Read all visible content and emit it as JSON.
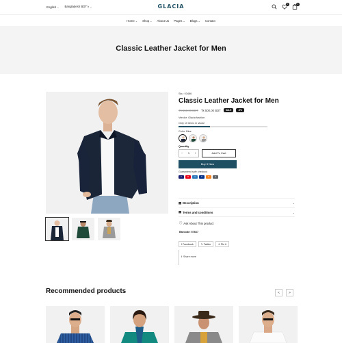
{
  "topbar": {
    "language": "English",
    "currency": "Bangladesh BDT ৳",
    "logo": "GLACIA",
    "wishlist_count": "0",
    "cart_count": "0"
  },
  "nav": [
    {
      "label": "Home",
      "dropdown": true
    },
    {
      "label": "Shop",
      "dropdown": true
    },
    {
      "label": "About Us",
      "dropdown": false
    },
    {
      "label": "Pages",
      "dropdown": true
    },
    {
      "label": "Blogs",
      "dropdown": true
    },
    {
      "label": "Contact",
      "dropdown": false
    }
  ],
  "hero": {
    "title": "Classic Leather Jacket for Men"
  },
  "product": {
    "sku": "Sku: 03486",
    "title": "Classic Leather Jacket for Men",
    "old_price": "Tk 550.00 BDT",
    "new_price": "Tk 500.00 BDT",
    "sale_label": "SALE",
    "discount_label": "-9%",
    "vendor": "Vendor: Glacia fashion",
    "stock_text": "Only 10 items in stock!",
    "stock_level": 0.35,
    "color_label": "Color: Blue",
    "colors": [
      "Blue",
      "Green",
      "Grey"
    ],
    "quantity_label": "Quantity",
    "quantity_value": "1",
    "add_to_cart": "Add To Cart",
    "buy_now": "Buy It Now",
    "guarantee": "Guaranteed safe checkout",
    "payment_icons": [
      "VISA",
      "MC",
      "AMEX",
      "PP",
      "DI",
      "GP"
    ],
    "description_label": "Description",
    "terms_label": "Terms and conditions",
    "ask_label": "Ask About This product",
    "barcode": "Barcode: 57667",
    "share_facebook": "Facebook",
    "share_twitter": "Twitter",
    "share_pinterest": "Pin it",
    "share_more": "Share more"
  },
  "recommended": {
    "title": "Recommended products",
    "prev": "<",
    "next": ">"
  },
  "colors": {
    "brand": "#1f4f63",
    "dark": "#1a1a1a",
    "hero_bg": "#f4f4f4"
  }
}
